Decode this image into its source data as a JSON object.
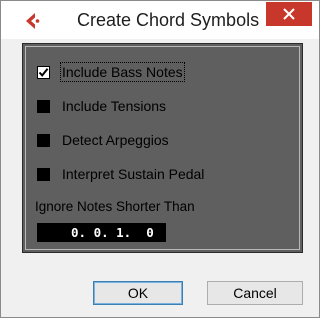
{
  "dialog": {
    "title": "Create Chord Symbols",
    "icons": {
      "app": "cubase-logo-icon",
      "close": "close-icon"
    },
    "accent_color": "#c7372c"
  },
  "options": [
    {
      "label": "Include Bass Notes",
      "checked": true
    },
    {
      "label": "Include Tensions",
      "checked": false
    },
    {
      "label": "Detect Arpeggios",
      "checked": false
    },
    {
      "label": "Interpret Sustain Pedal",
      "checked": false
    }
  ],
  "ignore": {
    "label": "Ignore Notes Shorter Than",
    "value": "0. 0. 1.  0"
  },
  "buttons": {
    "ok": "OK",
    "cancel": "Cancel"
  }
}
